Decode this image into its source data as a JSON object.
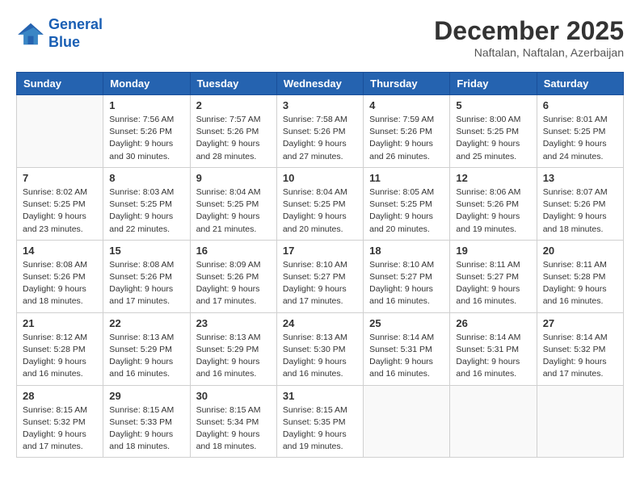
{
  "header": {
    "logo_line1": "General",
    "logo_line2": "Blue",
    "month_year": "December 2025",
    "location": "Naftalan, Naftalan, Azerbaijan"
  },
  "weekdays": [
    "Sunday",
    "Monday",
    "Tuesday",
    "Wednesday",
    "Thursday",
    "Friday",
    "Saturday"
  ],
  "weeks": [
    [
      {
        "day": "",
        "info": ""
      },
      {
        "day": "1",
        "info": "Sunrise: 7:56 AM\nSunset: 5:26 PM\nDaylight: 9 hours\nand 30 minutes."
      },
      {
        "day": "2",
        "info": "Sunrise: 7:57 AM\nSunset: 5:26 PM\nDaylight: 9 hours\nand 28 minutes."
      },
      {
        "day": "3",
        "info": "Sunrise: 7:58 AM\nSunset: 5:26 PM\nDaylight: 9 hours\nand 27 minutes."
      },
      {
        "day": "4",
        "info": "Sunrise: 7:59 AM\nSunset: 5:26 PM\nDaylight: 9 hours\nand 26 minutes."
      },
      {
        "day": "5",
        "info": "Sunrise: 8:00 AM\nSunset: 5:25 PM\nDaylight: 9 hours\nand 25 minutes."
      },
      {
        "day": "6",
        "info": "Sunrise: 8:01 AM\nSunset: 5:25 PM\nDaylight: 9 hours\nand 24 minutes."
      }
    ],
    [
      {
        "day": "7",
        "info": "Sunrise: 8:02 AM\nSunset: 5:25 PM\nDaylight: 9 hours\nand 23 minutes."
      },
      {
        "day": "8",
        "info": "Sunrise: 8:03 AM\nSunset: 5:25 PM\nDaylight: 9 hours\nand 22 minutes."
      },
      {
        "day": "9",
        "info": "Sunrise: 8:04 AM\nSunset: 5:25 PM\nDaylight: 9 hours\nand 21 minutes."
      },
      {
        "day": "10",
        "info": "Sunrise: 8:04 AM\nSunset: 5:25 PM\nDaylight: 9 hours\nand 20 minutes."
      },
      {
        "day": "11",
        "info": "Sunrise: 8:05 AM\nSunset: 5:25 PM\nDaylight: 9 hours\nand 20 minutes."
      },
      {
        "day": "12",
        "info": "Sunrise: 8:06 AM\nSunset: 5:26 PM\nDaylight: 9 hours\nand 19 minutes."
      },
      {
        "day": "13",
        "info": "Sunrise: 8:07 AM\nSunset: 5:26 PM\nDaylight: 9 hours\nand 18 minutes."
      }
    ],
    [
      {
        "day": "14",
        "info": "Sunrise: 8:08 AM\nSunset: 5:26 PM\nDaylight: 9 hours\nand 18 minutes."
      },
      {
        "day": "15",
        "info": "Sunrise: 8:08 AM\nSunset: 5:26 PM\nDaylight: 9 hours\nand 17 minutes."
      },
      {
        "day": "16",
        "info": "Sunrise: 8:09 AM\nSunset: 5:26 PM\nDaylight: 9 hours\nand 17 minutes."
      },
      {
        "day": "17",
        "info": "Sunrise: 8:10 AM\nSunset: 5:27 PM\nDaylight: 9 hours\nand 17 minutes."
      },
      {
        "day": "18",
        "info": "Sunrise: 8:10 AM\nSunset: 5:27 PM\nDaylight: 9 hours\nand 16 minutes."
      },
      {
        "day": "19",
        "info": "Sunrise: 8:11 AM\nSunset: 5:27 PM\nDaylight: 9 hours\nand 16 minutes."
      },
      {
        "day": "20",
        "info": "Sunrise: 8:11 AM\nSunset: 5:28 PM\nDaylight: 9 hours\nand 16 minutes."
      }
    ],
    [
      {
        "day": "21",
        "info": "Sunrise: 8:12 AM\nSunset: 5:28 PM\nDaylight: 9 hours\nand 16 minutes."
      },
      {
        "day": "22",
        "info": "Sunrise: 8:13 AM\nSunset: 5:29 PM\nDaylight: 9 hours\nand 16 minutes."
      },
      {
        "day": "23",
        "info": "Sunrise: 8:13 AM\nSunset: 5:29 PM\nDaylight: 9 hours\nand 16 minutes."
      },
      {
        "day": "24",
        "info": "Sunrise: 8:13 AM\nSunset: 5:30 PM\nDaylight: 9 hours\nand 16 minutes."
      },
      {
        "day": "25",
        "info": "Sunrise: 8:14 AM\nSunset: 5:31 PM\nDaylight: 9 hours\nand 16 minutes."
      },
      {
        "day": "26",
        "info": "Sunrise: 8:14 AM\nSunset: 5:31 PM\nDaylight: 9 hours\nand 16 minutes."
      },
      {
        "day": "27",
        "info": "Sunrise: 8:14 AM\nSunset: 5:32 PM\nDaylight: 9 hours\nand 17 minutes."
      }
    ],
    [
      {
        "day": "28",
        "info": "Sunrise: 8:15 AM\nSunset: 5:32 PM\nDaylight: 9 hours\nand 17 minutes."
      },
      {
        "day": "29",
        "info": "Sunrise: 8:15 AM\nSunset: 5:33 PM\nDaylight: 9 hours\nand 18 minutes."
      },
      {
        "day": "30",
        "info": "Sunrise: 8:15 AM\nSunset: 5:34 PM\nDaylight: 9 hours\nand 18 minutes."
      },
      {
        "day": "31",
        "info": "Sunrise: 8:15 AM\nSunset: 5:35 PM\nDaylight: 9 hours\nand 19 minutes."
      },
      {
        "day": "",
        "info": ""
      },
      {
        "day": "",
        "info": ""
      },
      {
        "day": "",
        "info": ""
      }
    ]
  ]
}
